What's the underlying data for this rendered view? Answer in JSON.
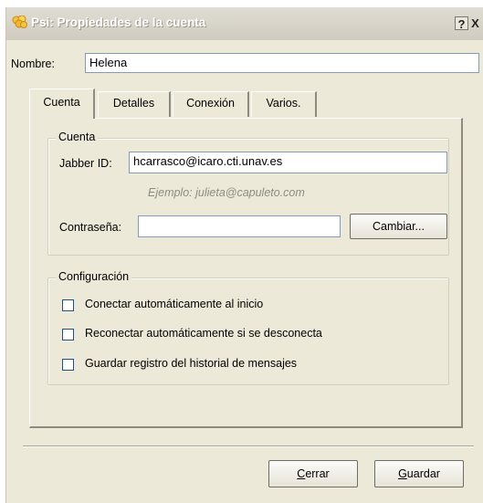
{
  "window": {
    "title": "Psi: Propiedades de la cuenta",
    "help_button": "?",
    "close_button": "X"
  },
  "name_field": {
    "label": "Nombre:",
    "value": "Helena"
  },
  "tabs": [
    {
      "label": "Cuenta",
      "active": true
    },
    {
      "label": "Detalles",
      "active": false
    },
    {
      "label": "Conexión",
      "active": false
    },
    {
      "label": "Varios.",
      "active": false
    }
  ],
  "account_group": {
    "title": "Cuenta",
    "jid_label": "Jabber ID:",
    "jid_value": "hcarrasco@icaro.cti.unav.es",
    "jid_hint": "Ejemplo: julieta@capuleto.com",
    "password_label": "Contraseña:",
    "password_value": "",
    "change_button": "Cambiar..."
  },
  "config_group": {
    "title": "Configuración",
    "options": [
      {
        "label": "Conectar automáticamente al inicio",
        "checked": false
      },
      {
        "label": "Reconectar automáticamente si se desconecta",
        "checked": false
      },
      {
        "label": "Guardar registro del historial de mensajes",
        "checked": false
      }
    ]
  },
  "footer": {
    "close_button": {
      "label": "Cerrar",
      "mnemonic": "C"
    },
    "save_button": {
      "label": "Guardar",
      "mnemonic": "G"
    }
  },
  "colors": {
    "dialog_bg": "#ece9d8",
    "field_border": "#7f9db9",
    "hint_text": "#8c8c86",
    "title_text": "#ffffff"
  },
  "icons": {
    "app": "psi-flower-icon",
    "help": "help-icon",
    "close": "close-icon"
  }
}
